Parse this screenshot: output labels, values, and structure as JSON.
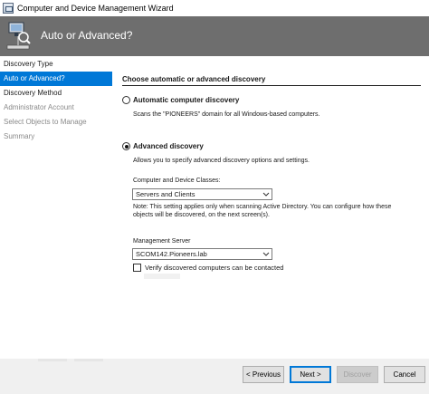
{
  "window": {
    "title": "Computer and Device Management Wizard"
  },
  "banner": {
    "title": "Auto or Advanced?"
  },
  "nav": {
    "items": [
      {
        "label": "Discovery Type",
        "state": "normal"
      },
      {
        "label": "Auto or Advanced?",
        "state": "active"
      },
      {
        "label": "Discovery Method",
        "state": "normal"
      },
      {
        "label": "Administrator Account",
        "state": "gray"
      },
      {
        "label": "Select Objects to Manage",
        "state": "gray"
      },
      {
        "label": "Summary",
        "state": "gray"
      }
    ]
  },
  "main": {
    "heading": "Choose automatic or advanced discovery",
    "automatic": {
      "label": "Automatic computer discovery",
      "description": "Scans the \"PIONEERS\" domain for all Windows-based computers.",
      "selected": false
    },
    "advanced": {
      "label": "Advanced discovery",
      "description": "Allows you to specify advanced discovery options and settings.",
      "selected": true
    },
    "classes": {
      "label": "Computer and Device Classes:",
      "value": "Servers and Clients"
    },
    "note": {
      "line1": "Note: This setting applies only when scanning Active Directory.  You can configure how these",
      "line2": "objects will be discovered, on the next screen(s)."
    },
    "server": {
      "label": "Management Server",
      "value": "SCOM142.Pioneers.lab"
    },
    "verify": {
      "label": "Verify discovered computers can be contacted",
      "checked": false
    }
  },
  "footer": {
    "previous": "< Previous",
    "next": "Next >",
    "discover": "Discover",
    "cancel": "Cancel"
  },
  "colors": {
    "accent": "#0078d7",
    "banner": "#6e6e6e"
  }
}
